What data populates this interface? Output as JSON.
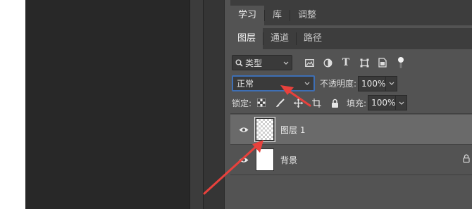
{
  "panel_tabs_top": [
    "学习",
    "库",
    "调整"
  ],
  "panel_tabs_layers": [
    "图层",
    "通道",
    "路径"
  ],
  "filter": {
    "kind_label": "类型"
  },
  "blend": {
    "mode": "正常"
  },
  "opacity": {
    "label": "不透明度:",
    "value": "100%"
  },
  "lock": {
    "label": "锁定:"
  },
  "fill": {
    "label": "填充:",
    "value": "100%"
  },
  "layers": [
    {
      "name": "图层 1",
      "selected": true,
      "thumbnail": "transparent"
    },
    {
      "name": "背景",
      "selected": false,
      "thumbnail": "white",
      "locked": true
    }
  ],
  "colors": {
    "panel_bg": "#535353",
    "selected_layer_bg": "#6a6a6a",
    "blend_border": "#3e6fb5",
    "annotation_arrow": "#e8413c"
  }
}
